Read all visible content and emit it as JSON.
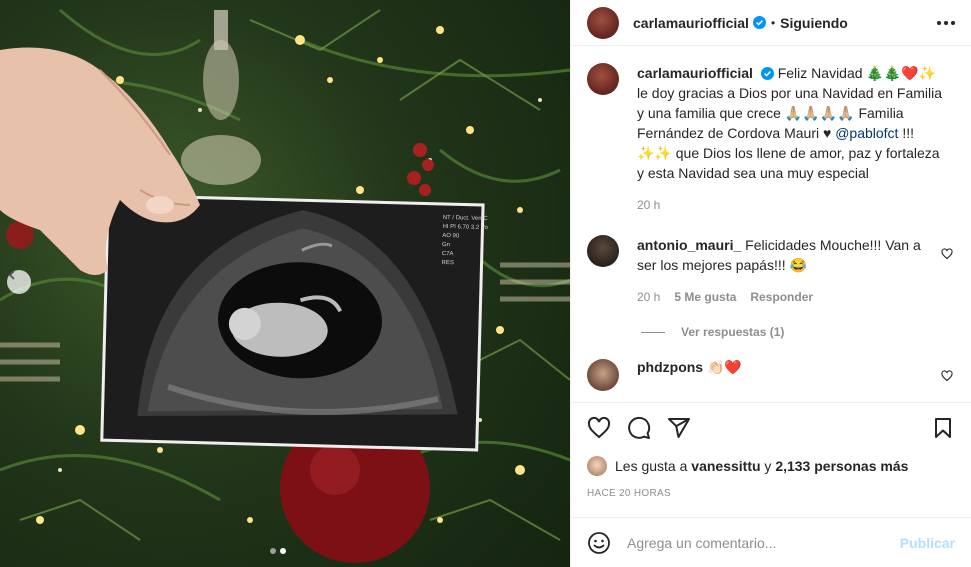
{
  "post": {
    "username": "carlamauriofficial",
    "separator": "•",
    "follow_status": "Siguiendo"
  },
  "caption": {
    "username": "carlamauriofficial",
    "text_before_mention": "Feliz Navidad 🎄🎄❤️✨ le doy gracias a Dios por una Navidad en Familia y una familia que crece 🙏🏼🙏🏼🙏🏼🙏🏼 Familia Fernández de Cordova Mauri ♥",
    "mention": "@pablofct",
    "text_after_mention": "!!! ✨✨ que Dios los llene de amor, paz y fortaleza y esta Navidad sea una muy especial",
    "time": "20 h"
  },
  "comments": [
    {
      "username": "antonio_mauri_",
      "text": "Felicidades Mouche!!! Van a ser los mejores papás!!! 😂",
      "time": "20 h",
      "likes": "5 Me gusta",
      "reply_label": "Responder",
      "view_replies": "Ver respuestas (1)"
    },
    {
      "username": "phdzpons",
      "text": "👏🏻❤️"
    }
  ],
  "likes": {
    "prefix": "Les gusta a",
    "user": "vanessittu",
    "joiner": "y",
    "others": "2,133 personas más"
  },
  "timestamp": "HACE 20 HORAS",
  "composer": {
    "placeholder": "Agrega un comentario...",
    "publish_label": "Publicar"
  },
  "ultrasound_text": "NT / Duct. Ven/C\nHI PI 6.70 3.2 Vo\nAO 90\nGn\nC7A\nRES",
  "colors": {
    "verified_blue": "#0095f6",
    "mention_blue": "#00376b",
    "meta_gray": "#8e8e8e",
    "publish_disabled": "#b2dffc"
  }
}
